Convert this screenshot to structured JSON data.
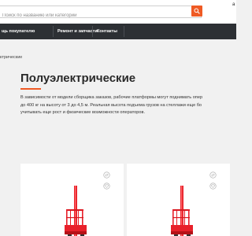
{
  "search": {
    "placeholder": "Поиск по названию или категории",
    "value": ""
  },
  "header": {
    "right_glyph": "а"
  },
  "nav": {
    "items": [
      {
        "label": "щь покупателю"
      },
      {
        "label": "Ремонт и запчасти"
      },
      {
        "label": "Контакты"
      }
    ]
  },
  "breadcrumb": {
    "current": "ктрические"
  },
  "page": {
    "title": "Полуэлектрические",
    "accent_color": "#ef5a24",
    "description_lines": [
      "В зависимости от модели сборщика заказов, рабочие платформы могут поднимать опер",
      "до 400 кг на высоту от 3 до 4,5 м.  Реальная высота подъема грузов на стеллажи еще бо",
      "учитывать еще рост и физические возможности операторов."
    ]
  },
  "products": [
    {
      "image": "red-order-picker",
      "actions": [
        "compare-icon",
        "favorite-icon"
      ]
    },
    {
      "image": "red-order-picker",
      "actions": [
        "compare-icon",
        "favorite-icon"
      ]
    }
  ],
  "colors": {
    "nav_bg": "#2d3034",
    "accent": "#ef5a24",
    "page_bg": "#f1f1f1",
    "product_red": "#e8202a"
  }
}
